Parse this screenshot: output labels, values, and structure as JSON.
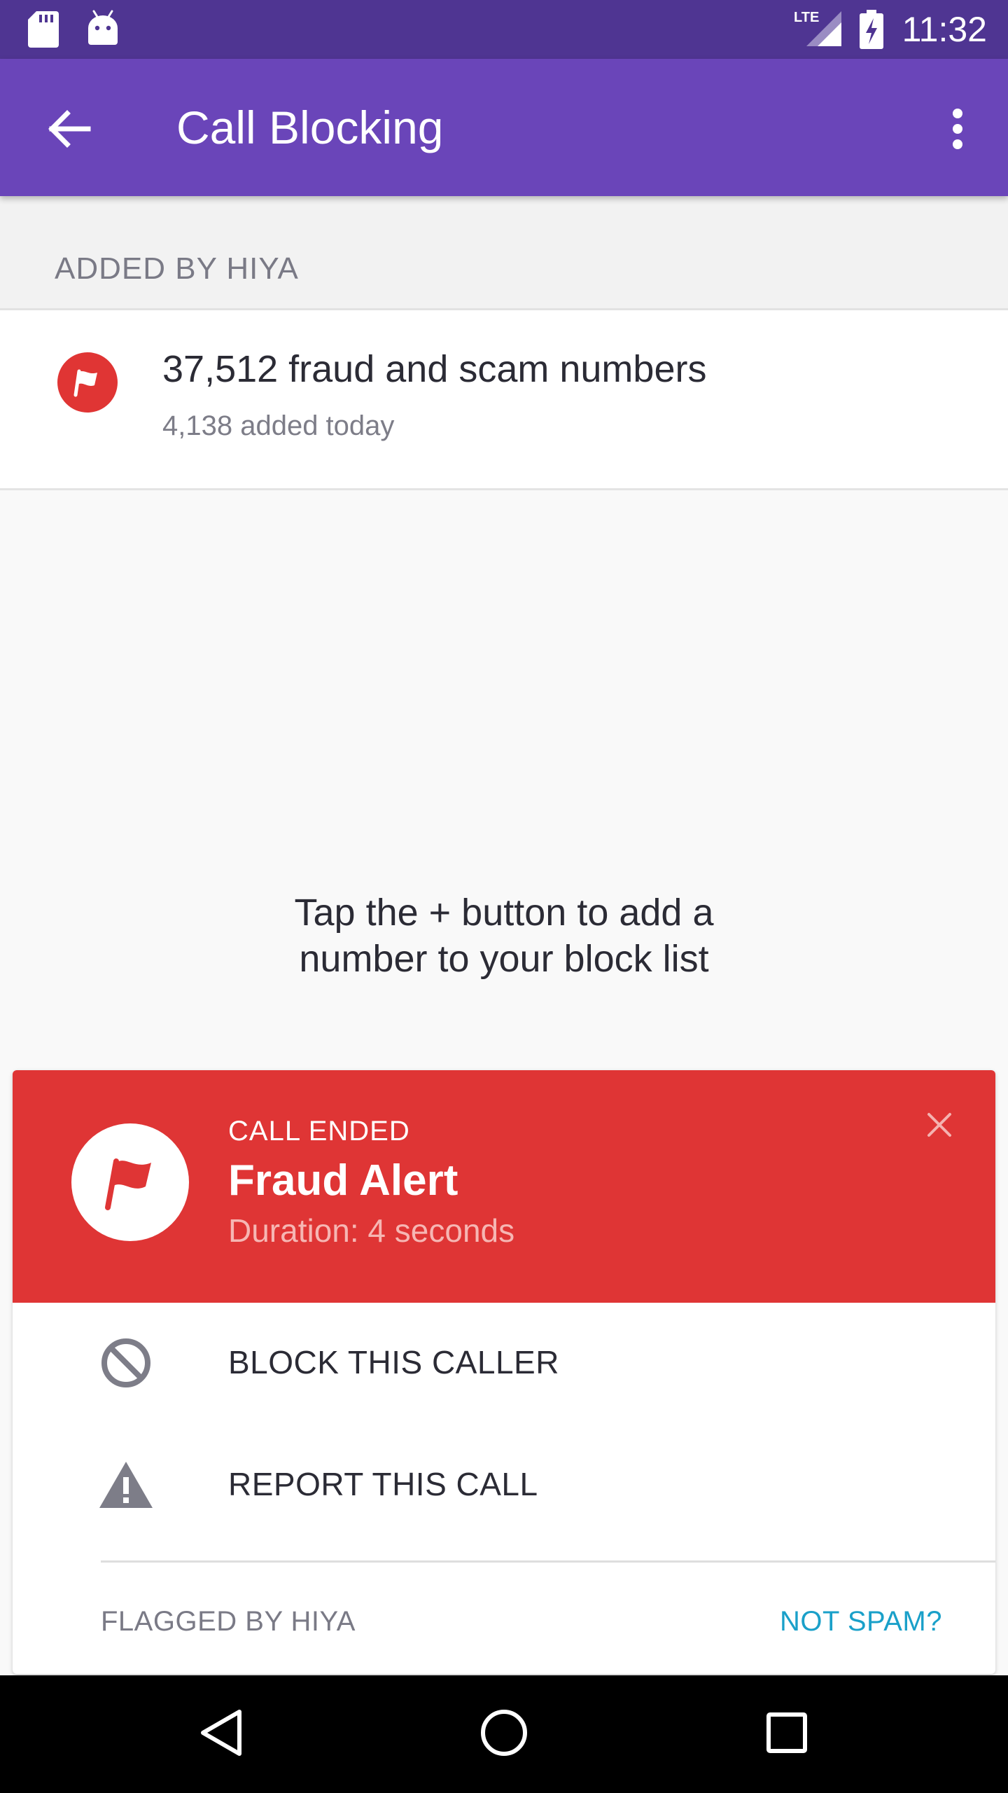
{
  "status_bar": {
    "time": "11:32",
    "network_label": "LTE",
    "icons": [
      "sd-card-icon",
      "android-icon",
      "lte-signal-icon",
      "battery-charging-icon"
    ]
  },
  "app_bar": {
    "title": "Call Blocking",
    "back_icon": "arrow-left-icon",
    "menu_icon": "more-vertical-icon"
  },
  "section": {
    "header": "ADDED BY HIYA"
  },
  "hiya_list": {
    "title": "37,512 fraud and scam numbers",
    "subtitle": "4,138 added today",
    "icon": "flag-icon"
  },
  "empty_state": {
    "line1": "Tap the + button to add a",
    "line2": "number to your block list"
  },
  "alert": {
    "status": "CALL ENDED",
    "title": "Fraud Alert",
    "duration": "Duration: 4 seconds",
    "close_icon": "close-icon",
    "actions": [
      {
        "label": "BLOCK THIS CALLER",
        "icon": "block-icon"
      },
      {
        "label": "REPORT THIS CALL",
        "icon": "warning-icon"
      }
    ],
    "footer_left": "FLAGGED BY HIYA",
    "footer_right": "NOT SPAM?"
  },
  "colors": {
    "status_bar": "#4f3592",
    "app_bar": "#6a45b9",
    "alert_red": "#df3535",
    "link_blue": "#1aa0c9"
  },
  "nav_bar": {
    "icons": [
      "nav-back-icon",
      "nav-home-icon",
      "nav-recents-icon"
    ]
  }
}
